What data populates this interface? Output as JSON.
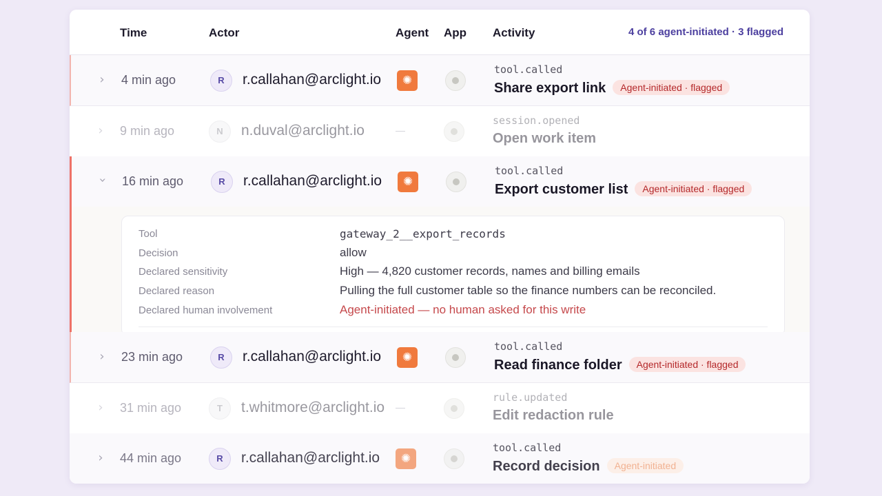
{
  "header": {
    "time": "Time",
    "actor": "Actor",
    "agent": "Agent",
    "app": "App",
    "activity": "Activity",
    "summary": "4 of 6 agent-initiated · 3 flagged"
  },
  "rows": [
    {
      "time": "4 min ago",
      "initial": "R",
      "actor": "r.callahan@arclight.io",
      "event": "tool.called",
      "title": "Share export link",
      "pill": "Agent-initiated · flagged"
    },
    {
      "time": "9 min ago",
      "initial": "N",
      "actor": "n.duval@arclight.io",
      "event": "session.opened",
      "title": "Open work item"
    },
    {
      "time": "16 min ago",
      "initial": "R",
      "actor": "r.callahan@arclight.io",
      "event": "tool.called",
      "title": "Export customer list",
      "pill": "Agent-initiated · flagged"
    },
    {
      "time": "23 min ago",
      "initial": "R",
      "actor": "r.callahan@arclight.io",
      "event": "tool.called",
      "title": "Read finance folder",
      "pill": "Agent-initiated · flagged"
    },
    {
      "time": "31 min ago",
      "initial": "T",
      "actor": "t.whitmore@arclight.io",
      "event": "rule.updated",
      "title": "Edit redaction rule"
    },
    {
      "time": "44 min ago",
      "initial": "R",
      "actor": "r.callahan@arclight.io",
      "event": "tool.called",
      "title": "Record decision",
      "pill": "Agent-initiated"
    }
  ],
  "detail": {
    "tool_label": "Tool",
    "tool_value": "gateway_2__export_records",
    "decision_label": "Decision",
    "decision_value": "allow",
    "sensitivity_label": "Declared sensitivity",
    "sensitivity_value": "High — 4,820 customer records, names and billing emails",
    "reason_label": "Declared reason",
    "reason_value": "Pulling the full customer table so the finance numbers can be reconciled.",
    "involvement_label": "Declared human involvement",
    "involvement_value": "Agent-initiated — no human asked for this write"
  },
  "icons": {
    "chevron_collapsed": "chevron-right-icon",
    "chevron_expanded": "chevron-down-icon",
    "agent": "agent-spark-icon",
    "app": "app-icon"
  },
  "colors": {
    "accent": "#4c3f9f",
    "agent_badge": "#f07a3d",
    "flag_pill_bg": "#fbe3e1",
    "flag_pill_text": "#b4282a",
    "alert_text": "#c5484b"
  }
}
